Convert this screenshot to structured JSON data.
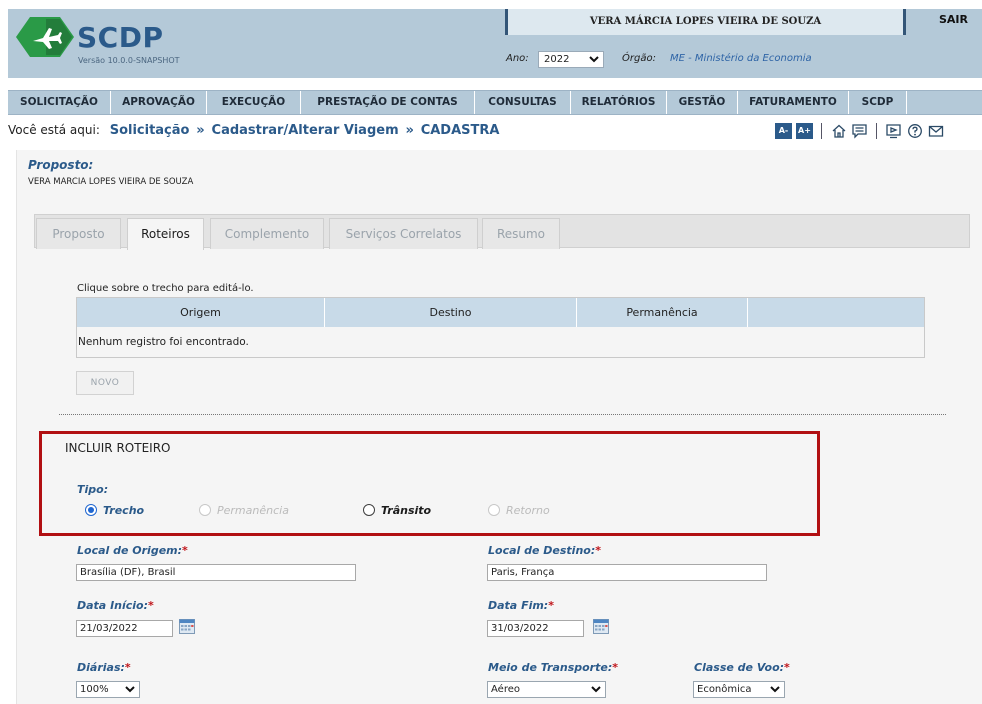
{
  "header": {
    "app_name": "SCDP",
    "version": "Versão 10.0.0-SNAPSHOT",
    "user_name": "VERA MÁRCIA LOPES VIEIRA DE SOUZA",
    "logout": "SAIR",
    "ano_label": "Ano:",
    "ano_value": "2022",
    "orgao_label": "Órgão:",
    "orgao_value": "ME - Ministério da Economia",
    "brand_color": "#2b5a8a"
  },
  "menu": {
    "items": [
      {
        "label": "SOLICITAÇÃO"
      },
      {
        "label": "APROVAÇÃO"
      },
      {
        "label": "EXECUÇÃO"
      },
      {
        "label": "PRESTAÇÃO DE CONTAS"
      },
      {
        "label": "CONSULTAS"
      },
      {
        "label": "RELATÓRIOS"
      },
      {
        "label": "GESTÃO"
      },
      {
        "label": "FATURAMENTO"
      },
      {
        "label": "SCDP"
      }
    ]
  },
  "breadcrumb": {
    "prefix": "Você está aqui:",
    "items": [
      "Solicitação",
      "Cadastrar/Alterar Viagem",
      "CADASTRA"
    ],
    "font_decrease": "A-",
    "font_increase": "A+",
    "icons": [
      "home-icon",
      "chat-icon",
      "presentation-icon",
      "help-icon",
      "mail-icon"
    ]
  },
  "proposto": {
    "title": "Proposto:",
    "name": "VERA MARCIA LOPES VIEIRA DE SOUZA"
  },
  "tabs": [
    {
      "label": "Proposto",
      "active": false
    },
    {
      "label": "Roteiros",
      "active": true
    },
    {
      "label": "Complemento",
      "active": false
    },
    {
      "label": "Serviços Correlatos",
      "active": false
    },
    {
      "label": "Resumo",
      "active": false
    }
  ],
  "roteiros": {
    "hint": "Clique sobre o trecho para editá-lo.",
    "columns": [
      "Origem",
      "Destino",
      "Permanência",
      ""
    ],
    "empty_message": "Nenhum registro foi encontrado.",
    "novo_button": "NOVO"
  },
  "incluir": {
    "title": "INCLUIR ROTEIRO",
    "tipo_label": "Tipo:",
    "options": [
      {
        "label": "Trecho",
        "checked": true,
        "enabled": true
      },
      {
        "label": "Permanência",
        "checked": false,
        "enabled": false
      },
      {
        "label": "Trânsito",
        "checked": false,
        "enabled": true
      },
      {
        "label": "Retorno",
        "checked": false,
        "enabled": false
      }
    ],
    "highlight_color": "#b10f12"
  },
  "form": {
    "origem_label": "Local de Origem:",
    "origem_value": "Brasília (DF), Brasil",
    "destino_label": "Local de Destino:",
    "destino_value": "Paris, França",
    "data_inicio_label": "Data Início:",
    "data_inicio_value": "21/03/2022",
    "data_fim_label": "Data Fim:",
    "data_fim_value": "31/03/2022",
    "diarias_label": "Diárias:",
    "diarias_value": "100%",
    "transporte_label": "Meio de Transporte:",
    "transporte_value": "Aéreo",
    "classe_label": "Classe de Voo:",
    "classe_value": "Econômica",
    "required_mark": "*"
  }
}
